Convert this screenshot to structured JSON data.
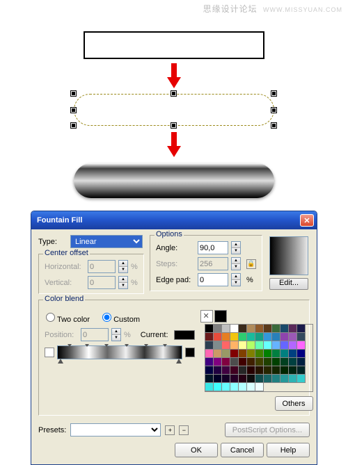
{
  "watermark": {
    "main": "思缘设计论坛",
    "sub": "WWW.MISSYUAN.COM"
  },
  "dialog": {
    "title": "Fountain Fill",
    "type_label": "Type:",
    "type_value": "Linear",
    "center_offset": {
      "title": "Center offset",
      "horizontal_label": "Horizontal:",
      "horizontal_value": "0",
      "vertical_label": "Vertical:",
      "vertical_value": "0",
      "pct": "%"
    },
    "options": {
      "title": "Options",
      "angle_label": "Angle:",
      "angle_value": "90,0",
      "steps_label": "Steps:",
      "steps_value": "256",
      "edgepad_label": "Edge pad:",
      "edgepad_value": "0",
      "pct": "%"
    },
    "preview_edit": "Edit...",
    "colorblend": {
      "title": "Color blend",
      "twocolor_label": "Two color",
      "custom_label": "Custom",
      "position_label": "Position:",
      "position_value": "0",
      "pct": "%",
      "current_label": "Current:",
      "others_label": "Others"
    },
    "presets": {
      "label": "Presets:",
      "value": "",
      "plus": "+",
      "minus": "−",
      "postscript_label": "PostScript Options..."
    },
    "buttons": {
      "ok": "OK",
      "cancel": "Cancel",
      "help": "Help"
    }
  },
  "palette_colors": [
    "#000000",
    "#7f7f7f",
    "#c0c0c0",
    "#ffffff",
    "#3a2a1a",
    "#b08b5a",
    "#8f5a2a",
    "#5a3a1a",
    "#3a6a3a",
    "#1a4a6a",
    "#5a2a5a",
    "#1a1a4a",
    "#6a1a1a",
    "#e74c3c",
    "#e67e22",
    "#f1c40f",
    "#2ecc71",
    "#1abc9c",
    "#16a085",
    "#3498db",
    "#2980b9",
    "#8e44ad",
    "#9b59b6",
    "#34495e",
    "#2c3e50",
    "#7f8c8d",
    "#ff6666",
    "#ffb366",
    "#ffff99",
    "#b3ff66",
    "#66ffb3",
    "#66ffff",
    "#66b3ff",
    "#6666ff",
    "#b366ff",
    "#ff66ff",
    "#ff66b3",
    "#cc9966",
    "#999966",
    "#800000",
    "#804000",
    "#808000",
    "#408000",
    "#008000",
    "#008040",
    "#008080",
    "#004080",
    "#000080",
    "#400080",
    "#800080",
    "#800040",
    "#4d4d4d",
    "#400000",
    "#402000",
    "#404000",
    "#204000",
    "#004000",
    "#004020",
    "#004040",
    "#002040",
    "#000040",
    "#200040",
    "#400040",
    "#400020",
    "#262626",
    "#260000",
    "#261300",
    "#262600",
    "#132600",
    "#002600",
    "#002613",
    "#002626",
    "#001326",
    "#000026",
    "#130026",
    "#260026",
    "#260013",
    "#0d0d0d",
    "#134d4d",
    "#1a6666",
    "#208080",
    "#269999",
    "#2db3b3",
    "#33cccc",
    "#39e6e6",
    "#40ffff",
    "#66ffff",
    "#8cffff",
    "#b3ffff",
    "#d9ffff",
    "#f0ffff"
  ]
}
